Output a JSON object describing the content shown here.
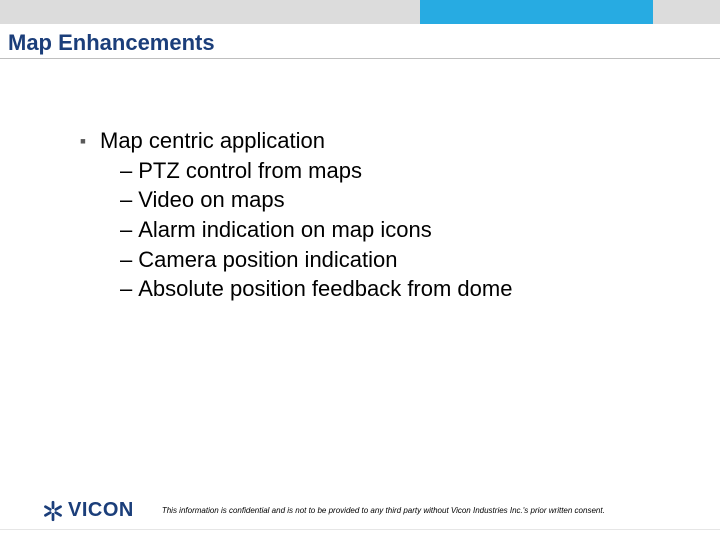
{
  "colors": {
    "accent": "#27abe2",
    "title": "#1b3e7a",
    "topbar": "#dcdcdc"
  },
  "header": {
    "title": "Map Enhancements"
  },
  "content": {
    "bullet": "Map centric application",
    "subs": [
      "PTZ control from maps",
      "Video on maps",
      "Alarm indication on map icons",
      "Camera position indication",
      "Absolute position feedback from dome"
    ]
  },
  "footer": {
    "logo_text": "VICON",
    "disclaimer": "This information is confidential and is not to be provided to any third party without Vicon Industries Inc.'s prior written consent."
  }
}
